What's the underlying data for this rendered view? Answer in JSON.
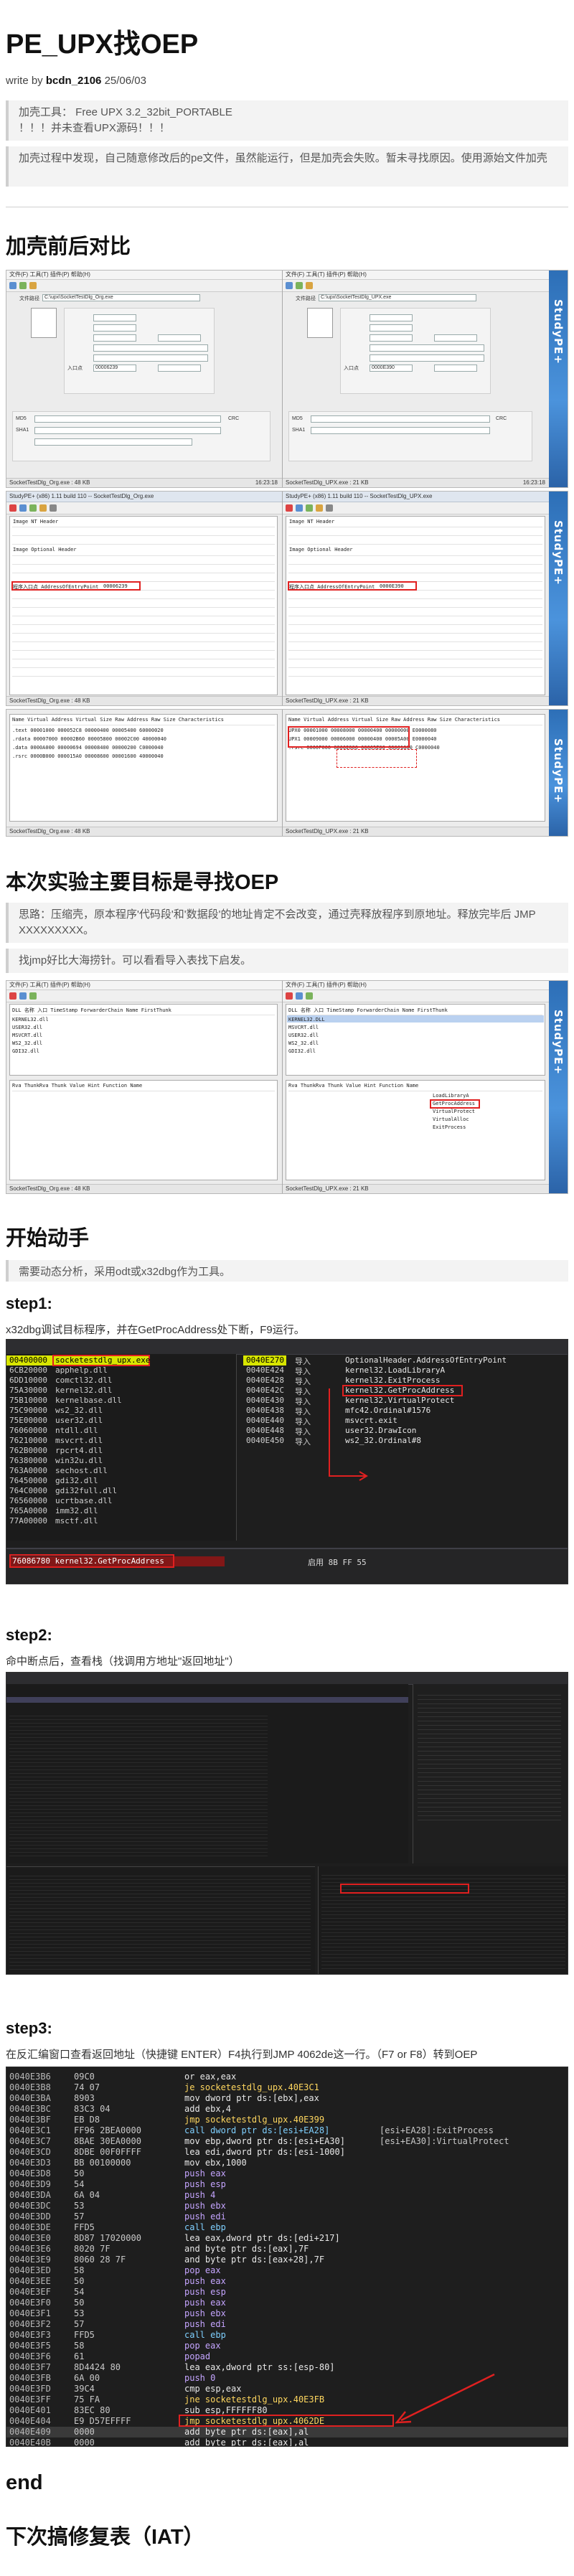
{
  "header": {
    "title": "PE_UPX找OEP",
    "write_by": "write by",
    "author": "bcdn_2106",
    "date": "25/06/03"
  },
  "intro": {
    "tool_line1": "加壳工具： Free UPX 3.2_32bit_PORTABLE",
    "tool_line2": "！！！并未查看UPX源码！！！",
    "process_text": "加壳过程中发现，自己随意修改后的pe文件，虽然能运行，但是加壳会失败。暂未寻找原因。使用源始文件加壳"
  },
  "section_compare": {
    "heading": "加壳前后对比",
    "sidebar_brand": "StudyPE+",
    "left_status": "SocketTestDlg_Org.exe : 48 KB",
    "right_status": "SocketTestDlg_UPX.exe : 21 KB",
    "time_left": "16:23:18",
    "time_right": "16:23:18",
    "win_title_left": "StudyPE+ (x86) 1.11 build 110 -- SocketTestDlg_Org.exe",
    "win_title_right": "StudyPE+ (x86) 1.11 build 110 -- SocketTestDlg_UPX.exe",
    "menu": "文件(F)  工具(T)  插件(P)  帮助(H)",
    "file_path_label": "文件路径",
    "left_path": "C:\\upx\\SocketTestDlg_Org.exe",
    "right_path": "C:\\upx\\SocketTestDlg_UPX.exe",
    "entry_label": "入口点",
    "left_entry_value": "00006239",
    "right_entry_value": "0000E390",
    "md5_label": "MD5",
    "sha1_label": "SHA1",
    "crc_label": "CRC",
    "pe_header_title": "Image NT Header",
    "optional_header_title": "Image Optional Header",
    "entry_row_label": "程序入口点 AddressOfEntryPoint",
    "section_header_title": "Name   Virtual Address  Virtual Size  Raw Address  Raw Size  Characteristics",
    "left_sections": [
      {
        "name": ".text",
        "va": "00001000",
        "vs": "000052C8",
        "ra": "00000400",
        "rs": "00005400",
        "ch": "60000020"
      },
      {
        "name": ".rdata",
        "va": "00007000",
        "vs": "00002B60",
        "ra": "00005800",
        "rs": "00002C00",
        "ch": "40000040"
      },
      {
        "name": ".data",
        "va": "0000A000",
        "vs": "00000694",
        "ra": "00008400",
        "rs": "00000200",
        "ch": "C0000040"
      },
      {
        "name": ".rsrc",
        "va": "0000B000",
        "vs": "000015A0",
        "ra": "00008600",
        "rs": "00001600",
        "ch": "40000040"
      }
    ],
    "right_sections": [
      {
        "name": "UPX0",
        "va": "00001000",
        "vs": "00008000",
        "ra": "00000400",
        "rs": "00000000",
        "ch": "E0000080"
      },
      {
        "name": "UPX1",
        "va": "00009000",
        "vs": "00006000",
        "ra": "00000400",
        "rs": "00005A00",
        "ch": "E0000040"
      },
      {
        "name": ".rsrc",
        "va": "0000F000",
        "vs": "00002000",
        "ra": "00005E00",
        "rs": "00001800",
        "ch": "C0000040"
      }
    ]
  },
  "section_goal": {
    "heading": "本次实验主要目标是寻找OEP",
    "thought": "思路：压缩壳，原本程序'代码段'和'数据段'的地址肯定不会改变，通过壳释放程序到原地址。释放完毕后 JMP XXXXXXXXX。",
    "iat_note": "找jmp好比大海捞针。可以看看导入表找下启发。",
    "import_cols": "DLL 名称   入口   TimeStamp  ForwarderChain  Name   FirstThunk",
    "left_dlls": [
      "KERNEL32.dll",
      "USER32.dll",
      "MSVCRT.dll",
      "WS2_32.dll",
      "GDI32.dll"
    ],
    "right_dlls": [
      "KERNEL32.DLL",
      "MSVCRT.dll",
      "USER32.dll",
      "WS2_32.dll",
      "GDI32.dll"
    ],
    "right_funcs": [
      "LoadLibraryA",
      "GetProcAddress",
      "VirtualProtect",
      "VirtualAlloc",
      "ExitProcess"
    ],
    "thunk_cols": "Rva    ThunkRva   Thunk Value   Hint   Function Name"
  },
  "section_start": {
    "heading": "开始动手",
    "note": "需要动态分析，采用odt或x32dbg作为工具。"
  },
  "step1": {
    "heading": "step1:",
    "text": "x32dbg调试目标程序，并在GetProcAddress处下断，F9运行。",
    "modules": [
      "socketestdlg_upx.exe",
      "apphelp.dll",
      "comctl32.dll",
      "kernel32.dll",
      "kernelbase.dll",
      "ws2_32.dll",
      "user32.dll",
      "ntdll.dll",
      "msvcrt.dll",
      "rpcrt4.dll",
      "win32u.dll",
      "sechost.dll",
      "gdi32.dll",
      "gdi32full.dll",
      "ucrtbase.dll",
      "imm32.dll",
      "msctf.dll"
    ],
    "module_addrs": [
      "00400000",
      "6CB20000",
      "6DD10000",
      "75A30000",
      "75B10000",
      "75C90000",
      "75E00000",
      "76060000",
      "76210000",
      "762B0000",
      "76380000",
      "763A0000",
      "76450000",
      "764C0000",
      "76560000",
      "765A0000",
      "77A00000"
    ],
    "imports": [
      {
        "addr": "0040E270",
        "tag": "导入",
        "name": "OptionalHeader.AddressOfEntryPoint"
      },
      {
        "addr": "0040E424",
        "tag": "导入",
        "name": "kernel32.LoadLibraryA"
      },
      {
        "addr": "0040E428",
        "tag": "导入",
        "name": "kernel32.ExitProcess"
      },
      {
        "addr": "0040E42C",
        "tag": "导入",
        "name": "kernel32.GetProcAddress"
      },
      {
        "addr": "0040E430",
        "tag": "导入",
        "name": "kernel32.VirtualProtect"
      },
      {
        "addr": "0040E438",
        "tag": "导入",
        "name": "mfc42.Ordinal#1576"
      },
      {
        "addr": "0040E440",
        "tag": "导入",
        "name": "msvcrt.exit"
      },
      {
        "addr": "0040E448",
        "tag": "导入",
        "name": "user32.DrawIcon"
      },
      {
        "addr": "0040E450",
        "tag": "导入",
        "name": "ws2_32.Ordinal#8"
      }
    ],
    "bp_row": "76086780  kernel32.GetProcAddress",
    "bp_state": "启用  8B FF 55"
  },
  "step2": {
    "heading": "step2:",
    "text": "命中断点后，查看栈（找调用方地址\"返回地址\"）"
  },
  "step3": {
    "heading": "step3:",
    "text": "在反汇编窗口查看返回地址（快捷键 ENTER）F4执行到JMP 4062de这一行。（F7 or F8）转到OEP",
    "rows": [
      {
        "a": "0040E3B6",
        "h": "09C0",
        "m": "or eax,eax",
        "c": ""
      },
      {
        "a": "0040E3B8",
        "h": "74 07",
        "m": "je socketestdlg_upx.40E3C1",
        "c": ""
      },
      {
        "a": "0040E3BA",
        "h": "8903",
        "m": "mov dword ptr ds:[ebx],eax",
        "c": ""
      },
      {
        "a": "0040E3BC",
        "h": "83C3 04",
        "m": "add ebx,4",
        "c": ""
      },
      {
        "a": "0040E3BF",
        "h": "EB D8",
        "m": "jmp socketestdlg_upx.40E399",
        "c": ""
      },
      {
        "a": "0040E3C1",
        "h": "FF96 2BEA0000",
        "m": "call dword ptr ds:[esi+EA28]",
        "c": "[esi+EA28]:ExitProcess"
      },
      {
        "a": "0040E3C7",
        "h": "8BAE 30EA0000",
        "m": "mov ebp,dword ptr ds:[esi+EA30]",
        "c": "[esi+EA30]:VirtualProtect"
      },
      {
        "a": "0040E3CD",
        "h": "8DBE 00F0FFFF",
        "m": "lea edi,dword ptr ds:[esi-1000]",
        "c": ""
      },
      {
        "a": "0040E3D3",
        "h": "BB 00100000",
        "m": "mov ebx,1000",
        "c": ""
      },
      {
        "a": "0040E3D8",
        "h": "50",
        "m": "push eax",
        "c": ""
      },
      {
        "a": "0040E3D9",
        "h": "54",
        "m": "push esp",
        "c": ""
      },
      {
        "a": "0040E3DA",
        "h": "6A 04",
        "m": "push 4",
        "c": ""
      },
      {
        "a": "0040E3DC",
        "h": "53",
        "m": "push ebx",
        "c": ""
      },
      {
        "a": "0040E3DD",
        "h": "57",
        "m": "push edi",
        "c": ""
      },
      {
        "a": "0040E3DE",
        "h": "FFD5",
        "m": "call ebp",
        "c": ""
      },
      {
        "a": "0040E3E0",
        "h": "8D87 17020000",
        "m": "lea eax,dword ptr ds:[edi+217]",
        "c": ""
      },
      {
        "a": "0040E3E6",
        "h": "8020 7F",
        "m": "and byte ptr ds:[eax],7F",
        "c": ""
      },
      {
        "a": "0040E3E9",
        "h": "8060 28 7F",
        "m": "and byte ptr ds:[eax+28],7F",
        "c": ""
      },
      {
        "a": "0040E3ED",
        "h": "58",
        "m": "pop eax",
        "c": ""
      },
      {
        "a": "0040E3EE",
        "h": "50",
        "m": "push eax",
        "c": ""
      },
      {
        "a": "0040E3EF",
        "h": "54",
        "m": "push esp",
        "c": ""
      },
      {
        "a": "0040E3F0",
        "h": "50",
        "m": "push eax",
        "c": ""
      },
      {
        "a": "0040E3F1",
        "h": "53",
        "m": "push ebx",
        "c": ""
      },
      {
        "a": "0040E3F2",
        "h": "57",
        "m": "push edi",
        "c": ""
      },
      {
        "a": "0040E3F3",
        "h": "FFD5",
        "m": "call ebp",
        "c": ""
      },
      {
        "a": "0040E3F5",
        "h": "58",
        "m": "pop eax",
        "c": ""
      },
      {
        "a": "0040E3F6",
        "h": "61",
        "m": "popad",
        "c": ""
      },
      {
        "a": "0040E3F7",
        "h": "8D4424 80",
        "m": "lea eax,dword ptr ss:[esp-80]",
        "c": ""
      },
      {
        "a": "0040E3FB",
        "h": "6A 00",
        "m": "push 0",
        "c": ""
      },
      {
        "a": "0040E3FD",
        "h": "39C4",
        "m": "cmp esp,eax",
        "c": ""
      },
      {
        "a": "0040E3FF",
        "h": "75 FA",
        "m": "jne socketestdlg_upx.40E3FB",
        "c": ""
      },
      {
        "a": "0040E401",
        "h": "83EC 80",
        "m": "sub esp,FFFFFF80",
        "c": ""
      },
      {
        "a": "0040E404",
        "h": "E9 D57EFFFF",
        "m": "jmp socketestdlg_upx.4062DE",
        "c": ""
      },
      {
        "a": "0040E409",
        "h": "0000",
        "m": "add byte ptr ds:[eax],al",
        "c": ""
      },
      {
        "a": "0040E40B",
        "h": "0000",
        "m": "add byte ptr ds:[eax],al",
        "c": ""
      }
    ]
  },
  "end": {
    "heading": "end"
  },
  "next": {
    "heading": "下次搞修复表（IAT）"
  }
}
